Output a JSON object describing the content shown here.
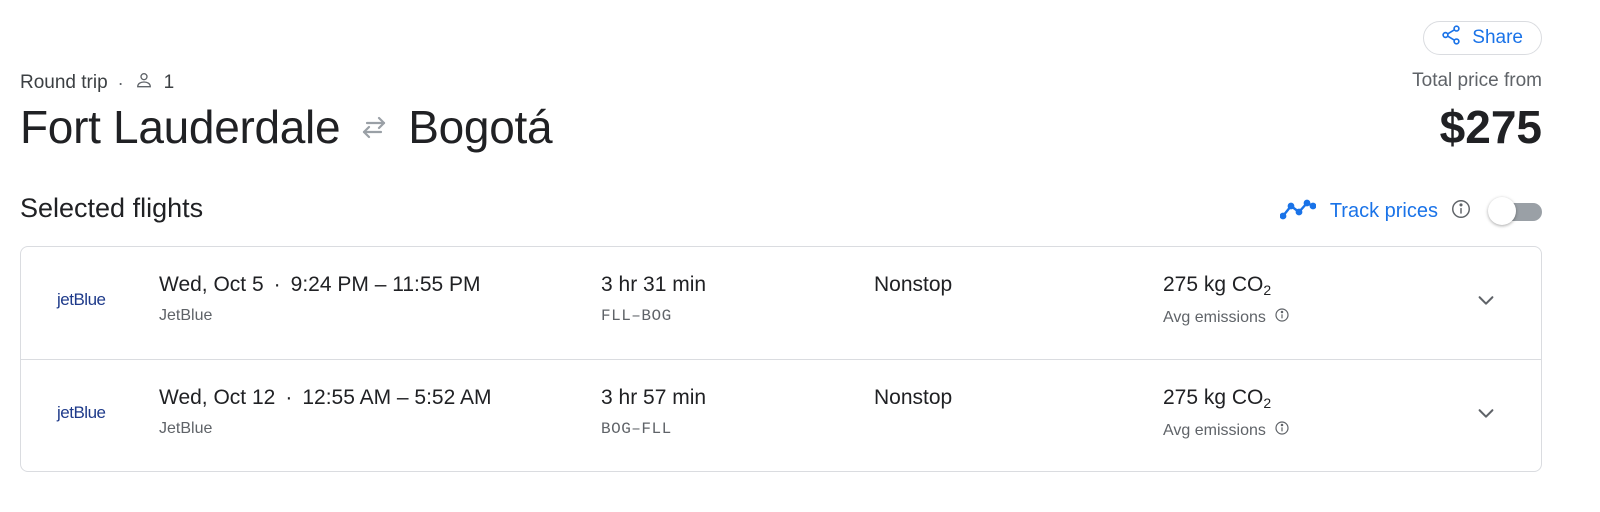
{
  "header": {
    "share_label": "Share",
    "trip_type": "Round trip",
    "passengers": "1",
    "origin": "Fort Lauderdale",
    "destination": "Bogotá",
    "price_label": "Total price from",
    "price": "$275"
  },
  "section": {
    "title": "Selected flights",
    "track_label": "Track prices",
    "track_enabled": false
  },
  "flights": [
    {
      "logo": "jetBlue",
      "date": "Wed, Oct 5",
      "time_range": "9:24 PM – 11:55 PM",
      "airline": "JetBlue",
      "duration": "3 hr 31 min",
      "route": "FLL–BOG",
      "stops": "Nonstop",
      "emissions_value": "275 kg CO",
      "emissions_sub": "2",
      "emissions_label": "Avg emissions"
    },
    {
      "logo": "jetBlue",
      "date": "Wed, Oct 12",
      "time_range": "12:55 AM – 5:52 AM",
      "airline": "JetBlue",
      "duration": "3 hr 57 min",
      "route": "BOG–FLL",
      "stops": "Nonstop",
      "emissions_value": "275 kg CO",
      "emissions_sub": "2",
      "emissions_label": "Avg emissions"
    }
  ],
  "colors": {
    "accent": "#1a73e8",
    "text": "#202124",
    "muted": "#5f6368",
    "border": "#dadce0",
    "logo": "#1e3a8a"
  },
  "icons": {
    "share": "share-icon",
    "person": "person-icon",
    "swap": "swap-arrows-icon",
    "trend": "trend-line-icon",
    "info": "info-icon",
    "expand": "chevron-down-icon"
  }
}
